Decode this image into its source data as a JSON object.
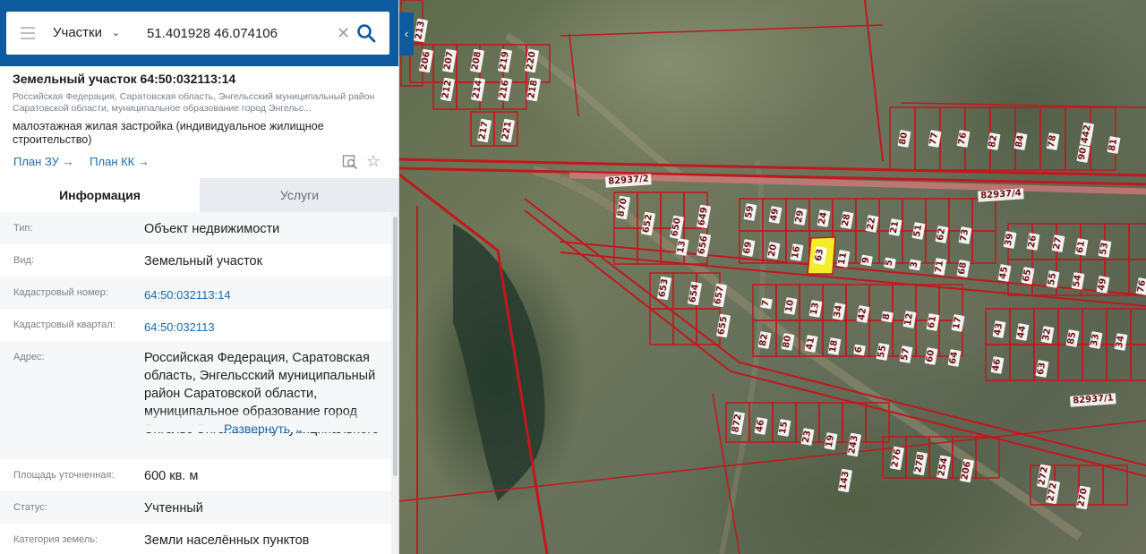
{
  "search": {
    "layer": "Участки",
    "query": "51.401928 46.074106"
  },
  "object": {
    "title": "Земельный участок 64:50:032113:14",
    "address_short": "Российская Федерация, Саратовская область, Энгельсский муниципальный район Саратовской области, муниципальное образование город Энгельс...",
    "use": "малоэтажная жилая застройка (индивидуальное жилищное строительство)",
    "plan_zu": "План ЗУ →",
    "plan_kk": "План КК →"
  },
  "tabs": [
    "Информация",
    "Услуги"
  ],
  "props": [
    {
      "key": "Тип:",
      "value": "Объект недвижимости",
      "link": false
    },
    {
      "key": "Вид:",
      "value": "Земельный участок",
      "link": false
    },
    {
      "key": "Кадастровый номер:",
      "value": "64:50:032113:14",
      "link": true
    },
    {
      "key": "Кадастровый квартал:",
      "value": "64:50:032113",
      "link": true
    },
    {
      "key": "Адрес:",
      "value": "Российская Федерация, Саратовская область, Энгельсский муниципальный район Саратовской области, муниципальное образование город Энгельс Энгельсского муниципального",
      "link": false
    },
    {
      "key": "Площадь уточненная:",
      "value": "600 кв. м",
      "link": false
    },
    {
      "key": "Статус:",
      "value": "Учтенный",
      "link": false
    },
    {
      "key": "Категория земель:",
      "value": "Земли населённых пунктов",
      "link": false
    }
  ],
  "expand_label": "Развернуть",
  "map": {
    "road_labels": [
      "82937/2",
      "82937/4",
      "82937/1"
    ],
    "plot_labels": [
      "213",
      "206",
      "207",
      "208",
      "219",
      "220",
      "212",
      "214",
      "216",
      "218",
      "217",
      "221",
      "80",
      "77",
      "76",
      "82",
      "84",
      "78",
      "442",
      "90",
      "81",
      "870",
      "652",
      "650",
      "649",
      "13",
      "656",
      "59",
      "49",
      "29",
      "24",
      "28",
      "22",
      "21",
      "51",
      "62",
      "73",
      "39",
      "26",
      "27",
      "61",
      "53",
      "69",
      "20",
      "16",
      "63",
      "11",
      "9",
      "5",
      "3",
      "71",
      "68",
      "45",
      "65",
      "55",
      "54",
      "49",
      "76",
      "653",
      "654",
      "657",
      "655",
      "7",
      "10",
      "13",
      "34",
      "42",
      "8",
      "12",
      "61",
      "17",
      "43",
      "44",
      "32",
      "85",
      "33",
      "34",
      "82",
      "80",
      "41",
      "18",
      "6",
      "55",
      "57",
      "60",
      "64",
      "46",
      "63",
      "872",
      "46",
      "15",
      "23",
      "19",
      "243",
      "276",
      "278",
      "254",
      "206",
      "143",
      "272",
      "272",
      "270"
    ],
    "selected_plot": "63",
    "colors": {
      "boundary": "#c2171d",
      "selected_fill": "#f4ee2a",
      "header_blue": "#0e5a9e",
      "link_blue": "#1a6ab3"
    }
  }
}
